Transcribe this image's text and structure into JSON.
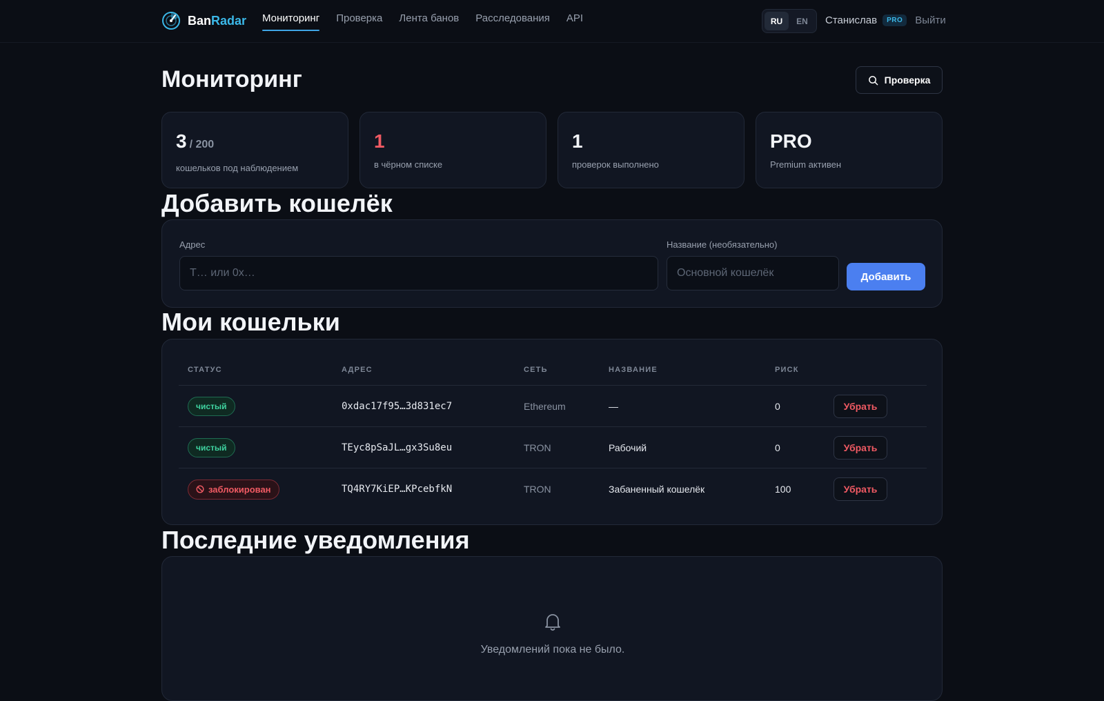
{
  "app": {
    "logo_part1": "Ban",
    "logo_part2": "Radar"
  },
  "nav": {
    "items": [
      {
        "label": "Мониторинг",
        "active": true
      },
      {
        "label": "Проверка"
      },
      {
        "label": "Лента банов"
      },
      {
        "label": "Расследования"
      },
      {
        "label": "API"
      }
    ]
  },
  "lang": {
    "ru": "RU",
    "en": "EN",
    "selected": "RU"
  },
  "user": {
    "name": "Станислав",
    "plan_badge": "PRO",
    "logout": "Выйти"
  },
  "page": {
    "title": "Мониторинг",
    "check_button": "Проверка"
  },
  "stats": [
    {
      "value": "3",
      "sub": "/ 200",
      "label": "кошельков под наблюдением"
    },
    {
      "value": "1",
      "label": "в чёрном списке"
    },
    {
      "value": "1",
      "label": "проверок выполнено"
    },
    {
      "value": "PRO",
      "label": "Premium активен"
    }
  ],
  "add_wallet": {
    "title": "Добавить кошелёк",
    "address_label": "Адрес",
    "address_placeholder": "T… или 0x…",
    "name_label": "Название (необязательно)",
    "name_placeholder": "Основной кошелёк",
    "add_button": "Добавить"
  },
  "wallets": {
    "title": "Мои кошельки",
    "columns": [
      "СТАТУС",
      "АДРЕС",
      "СЕТЬ",
      "НАЗВАНИЕ",
      "РИСК"
    ],
    "rows": [
      {
        "status": "чистый",
        "status_type": "clean",
        "address": "0xdac17f95…3d831ec7",
        "network": "Ethereum",
        "name": "—",
        "risk": "0",
        "action": "Убрать"
      },
      {
        "status": "чистый",
        "status_type": "clean",
        "address": "TEyc8pSaJL…gx3Su8eu",
        "network": "TRON",
        "name": "Рабочий",
        "risk": "0",
        "action": "Убрать"
      },
      {
        "status": "заблокирован",
        "status_type": "blocked",
        "address": "TQ4RY7KiEP…KPcebfkN",
        "network": "TRON",
        "name": "Забаненный кошелёк",
        "risk": "100",
        "action": "Убрать"
      }
    ]
  },
  "notifications": {
    "title": "Последние уведомления",
    "empty_text": "Уведомлений пока не было."
  },
  "colors": {
    "background": "#0b0e15",
    "card": "#111622",
    "accent_blue": "#4b7ff0",
    "accent_cyan": "#3bb8e8",
    "danger": "#f05a63",
    "success": "#3fd3a0"
  }
}
